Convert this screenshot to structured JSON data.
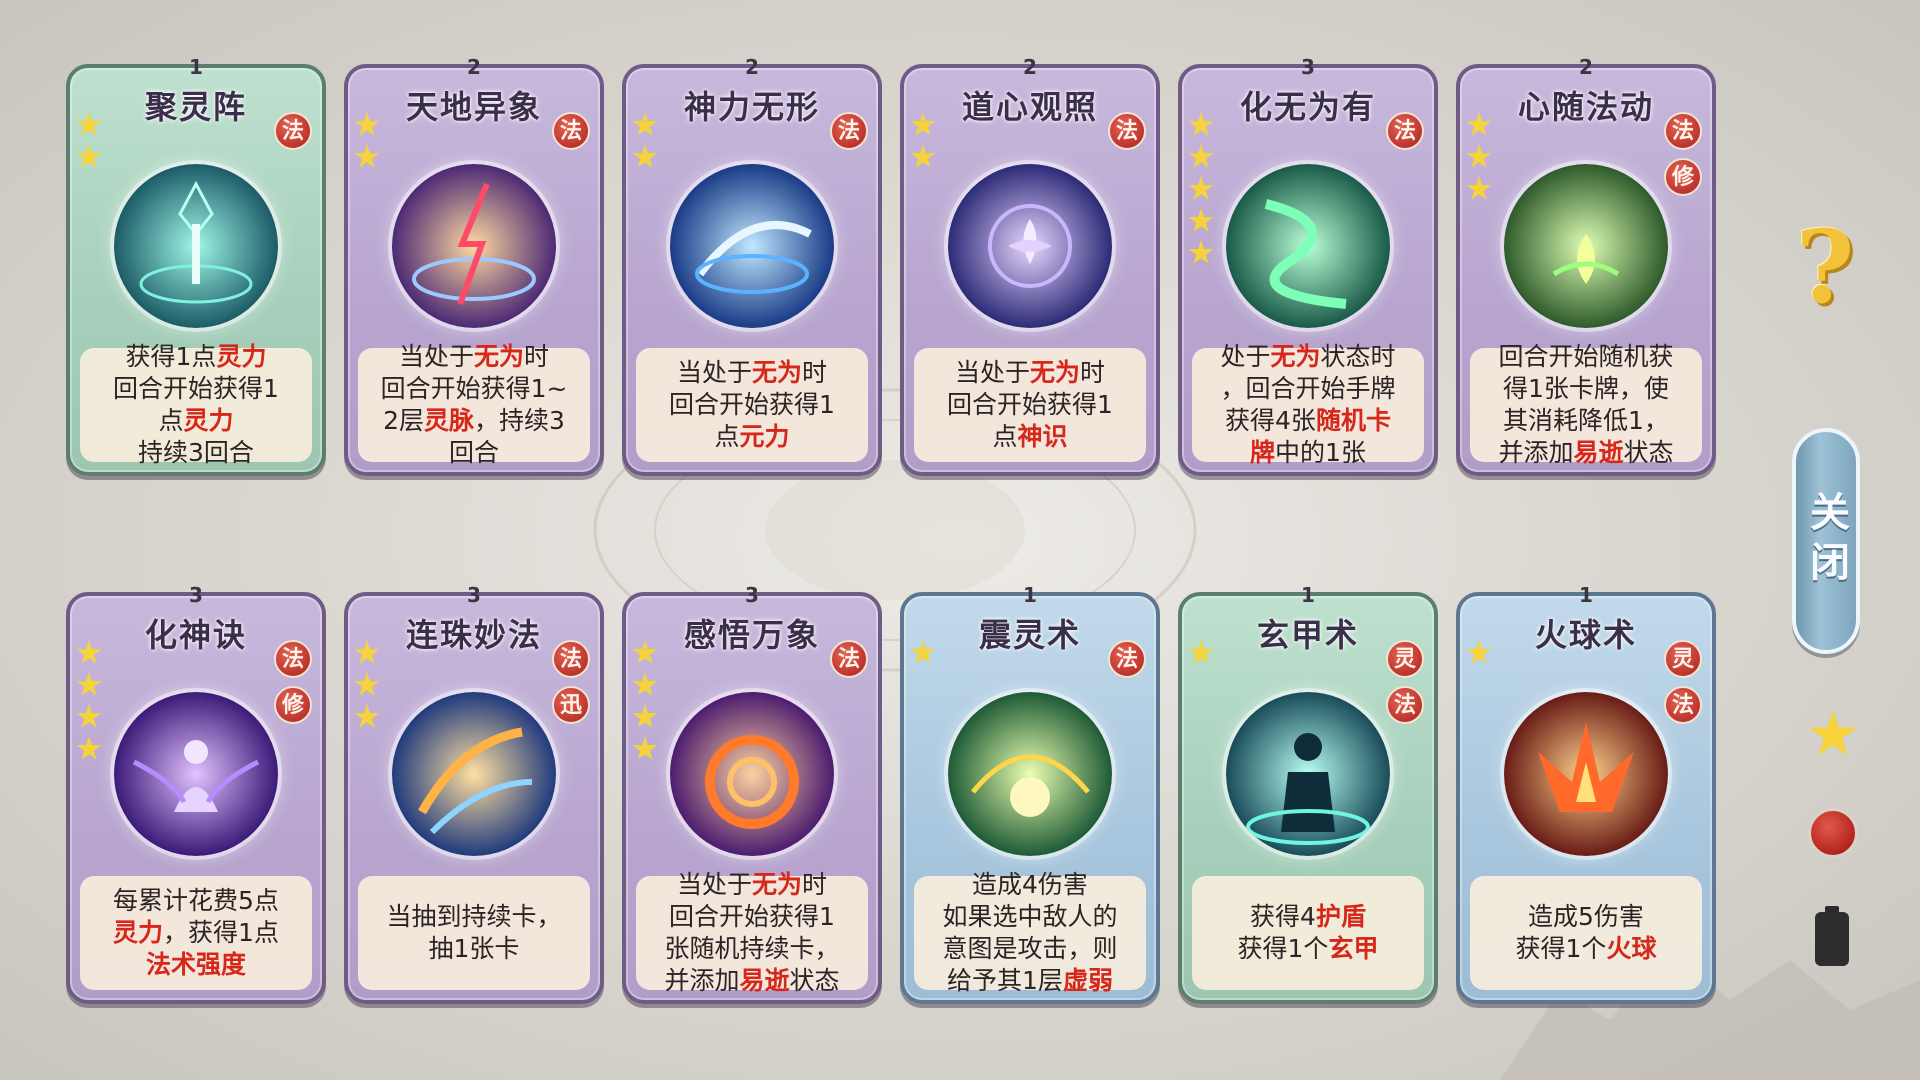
{
  "colors": {
    "highlight": "#d7261a",
    "tag_red": "#c43a32",
    "star_gold": "#f6d33a",
    "card_purple": "#b8a6d0",
    "card_green": "#a7d0bc",
    "card_blue": "#a9c7de"
  },
  "cards": [
    {
      "cost": "1",
      "title": "聚灵阵",
      "theme": "green",
      "stars": 2,
      "tags": [
        "法"
      ],
      "art": "teal-array-icon",
      "lines": [
        [
          {
            "t": "获得1点"
          },
          {
            "t": "灵力",
            "hl": true
          }
        ],
        [
          {
            "t": "回合开始获得1"
          }
        ],
        [
          {
            "t": "点"
          },
          {
            "t": "灵力",
            "hl": true
          }
        ],
        [
          {
            "t": "持续3回合"
          }
        ]
      ]
    },
    {
      "cost": "2",
      "title": "天地异象",
      "theme": "purple",
      "stars": 2,
      "tags": [
        "法"
      ],
      "art": "lightning-vortex-icon",
      "lines": [
        [
          {
            "t": "当处于"
          },
          {
            "t": "无为",
            "hl": true
          },
          {
            "t": "时"
          }
        ],
        [
          {
            "t": "回合开始获得1~"
          }
        ],
        [
          {
            "t": "2层"
          },
          {
            "t": "灵脉",
            "hl": true
          },
          {
            "t": "，持续3"
          }
        ],
        [
          {
            "t": "回合"
          }
        ]
      ]
    },
    {
      "cost": "2",
      "title": "神力无形",
      "theme": "purple",
      "stars": 2,
      "tags": [
        "法"
      ],
      "art": "blue-swirl-icon",
      "lines": [
        [
          {
            "t": "当处于"
          },
          {
            "t": "无为",
            "hl": true
          },
          {
            "t": "时"
          }
        ],
        [
          {
            "t": "回合开始获得1"
          }
        ],
        [
          {
            "t": "点"
          },
          {
            "t": "元力",
            "hl": true
          }
        ]
      ]
    },
    {
      "cost": "2",
      "title": "道心观照",
      "theme": "purple",
      "stars": 2,
      "tags": [
        "法"
      ],
      "art": "lotus-compass-icon",
      "lines": [
        [
          {
            "t": "当处于"
          },
          {
            "t": "无为",
            "hl": true
          },
          {
            "t": "时"
          }
        ],
        [
          {
            "t": "回合开始获得1"
          }
        ],
        [
          {
            "t": "点"
          },
          {
            "t": "神识",
            "hl": true
          }
        ]
      ]
    },
    {
      "cost": "3",
      "title": "化无为有",
      "theme": "purple",
      "stars": 5,
      "tags": [
        "法"
      ],
      "art": "green-spiral-icon",
      "lines": [
        [
          {
            "t": "处于"
          },
          {
            "t": "无为",
            "hl": true
          },
          {
            "t": "状态时"
          }
        ],
        [
          {
            "t": "，回合开始手牌"
          }
        ],
        [
          {
            "t": "获得4张"
          },
          {
            "t": "随机卡",
            "hl": true
          }
        ],
        [
          {
            "t": "牌",
            "hl": true
          },
          {
            "t": "中的1张"
          }
        ]
      ]
    },
    {
      "cost": "2",
      "title": "心随法动",
      "theme": "purple",
      "stars": 3,
      "tags": [
        "法",
        "修"
      ],
      "art": "green-lotus-icon",
      "lines": [
        [
          {
            "t": "回合开始随机获"
          }
        ],
        [
          {
            "t": "得1张卡牌，使"
          }
        ],
        [
          {
            "t": "其消耗降低1，"
          }
        ],
        [
          {
            "t": "并添加"
          },
          {
            "t": "易逝",
            "hl": true
          },
          {
            "t": "状态"
          }
        ]
      ]
    },
    {
      "cost": "3",
      "title": "化神诀",
      "theme": "purple",
      "stars": 4,
      "tags": [
        "法",
        "修"
      ],
      "art": "meditating-figure-icon",
      "lines": [
        [
          {
            "t": "每累计花费5点"
          }
        ],
        [
          {
            "t": "灵力",
            "hl": true
          },
          {
            "t": "，获得1点"
          }
        ],
        [
          {
            "t": "法术强度",
            "hl": true
          }
        ]
      ]
    },
    {
      "cost": "3",
      "title": "连珠妙法",
      "theme": "purple",
      "stars": 3,
      "tags": [
        "法",
        "迅"
      ],
      "art": "flame-slashes-icon",
      "lines": [
        [
          {
            "t": "当抽到持续卡，"
          }
        ],
        [
          {
            "t": "抽1张卡"
          }
        ]
      ]
    },
    {
      "cost": "3",
      "title": "感悟万象",
      "theme": "purple",
      "stars": 4,
      "tags": [
        "法"
      ],
      "art": "fire-vortex-icon",
      "lines": [
        [
          {
            "t": "当处于"
          },
          {
            "t": "无为",
            "hl": true
          },
          {
            "t": "时"
          }
        ],
        [
          {
            "t": "回合开始获得1"
          }
        ],
        [
          {
            "t": "张随机持续卡，"
          }
        ],
        [
          {
            "t": "并添加"
          },
          {
            "t": "易逝",
            "hl": true
          },
          {
            "t": "状态"
          }
        ]
      ]
    },
    {
      "cost": "1",
      "title": "震灵术",
      "theme": "blue",
      "stars": 1,
      "tags": [
        "法"
      ],
      "art": "green-orb-icon",
      "lines": [
        [
          {
            "t": "造成4伤害"
          }
        ],
        [
          {
            "t": "如果选中敌人的"
          }
        ],
        [
          {
            "t": "意图是攻击，则"
          }
        ],
        [
          {
            "t": "给予其1层"
          },
          {
            "t": "虚弱",
            "hl": true
          }
        ]
      ]
    },
    {
      "cost": "1",
      "title": "玄甲术",
      "theme": "green",
      "stars": 1,
      "tags": [
        "灵",
        "法"
      ],
      "art": "armored-figure-icon",
      "lines": [
        [
          {
            "t": "获得4"
          },
          {
            "t": "护盾",
            "hl": true
          }
        ],
        [
          {
            "t": "获得1个"
          },
          {
            "t": "玄甲",
            "hl": true
          }
        ]
      ]
    },
    {
      "cost": "1",
      "title": "火球术",
      "theme": "blue",
      "stars": 1,
      "tags": [
        "灵",
        "法"
      ],
      "art": "fire-burst-icon",
      "lines": [
        [
          {
            "t": "造成5伤害"
          }
        ],
        [
          {
            "t": "获得1个"
          },
          {
            "t": "火球",
            "hl": true
          }
        ]
      ]
    }
  ],
  "sidebar": {
    "help_icon": "question-icon",
    "close_label": "关闭",
    "filters": [
      "star-filter-icon",
      "red-dot-filter-icon",
      "battery-filter-icon"
    ]
  }
}
